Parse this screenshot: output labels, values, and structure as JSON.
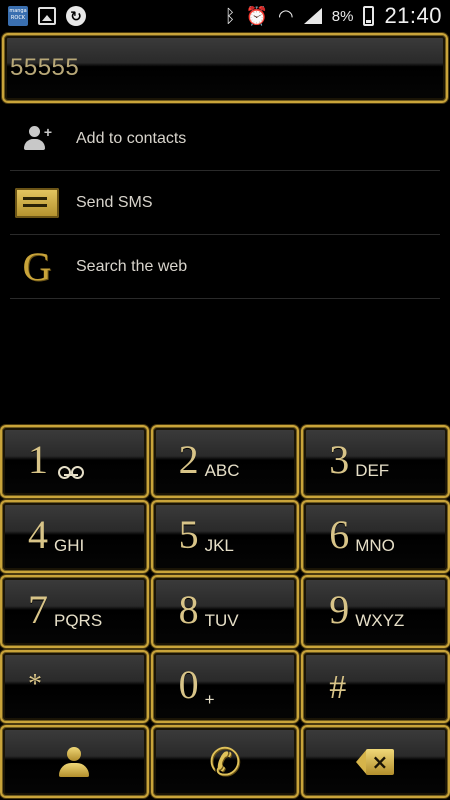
{
  "status_bar": {
    "app_badge_text": "manga ROCK",
    "battery_percent": "8%",
    "time": "21:40",
    "icons": [
      "mangarock-icon",
      "gallery-icon",
      "sync-icon",
      "bluetooth-icon",
      "alarm-icon",
      "wifi-icon",
      "signal-icon",
      "battery-icon"
    ]
  },
  "dialer": {
    "number": "55555"
  },
  "suggestions": [
    {
      "icon": "add-contact-icon",
      "label": "Add to contacts"
    },
    {
      "icon": "sms-icon",
      "label": "Send SMS"
    },
    {
      "icon": "google-icon",
      "label": "Search the web"
    }
  ],
  "keypad": {
    "keys": [
      {
        "digit": "1",
        "letters": "",
        "icon": "voicemail-icon"
      },
      {
        "digit": "2",
        "letters": "ABC"
      },
      {
        "digit": "3",
        "letters": "DEF"
      },
      {
        "digit": "4",
        "letters": "GHI"
      },
      {
        "digit": "5",
        "letters": "JKL"
      },
      {
        "digit": "6",
        "letters": "MNO"
      },
      {
        "digit": "7",
        "letters": "PQRS"
      },
      {
        "digit": "8",
        "letters": "TUV"
      },
      {
        "digit": "9",
        "letters": "WXYZ"
      },
      {
        "digit": "*",
        "letters": ""
      },
      {
        "digit": "0",
        "letters": "+"
      },
      {
        "digit": "#",
        "letters": ""
      }
    ],
    "actions": [
      "contacts-icon",
      "call-icon",
      "backspace-icon"
    ]
  },
  "colors": {
    "accent_gold": "#c9a43a",
    "background": "#000000"
  }
}
